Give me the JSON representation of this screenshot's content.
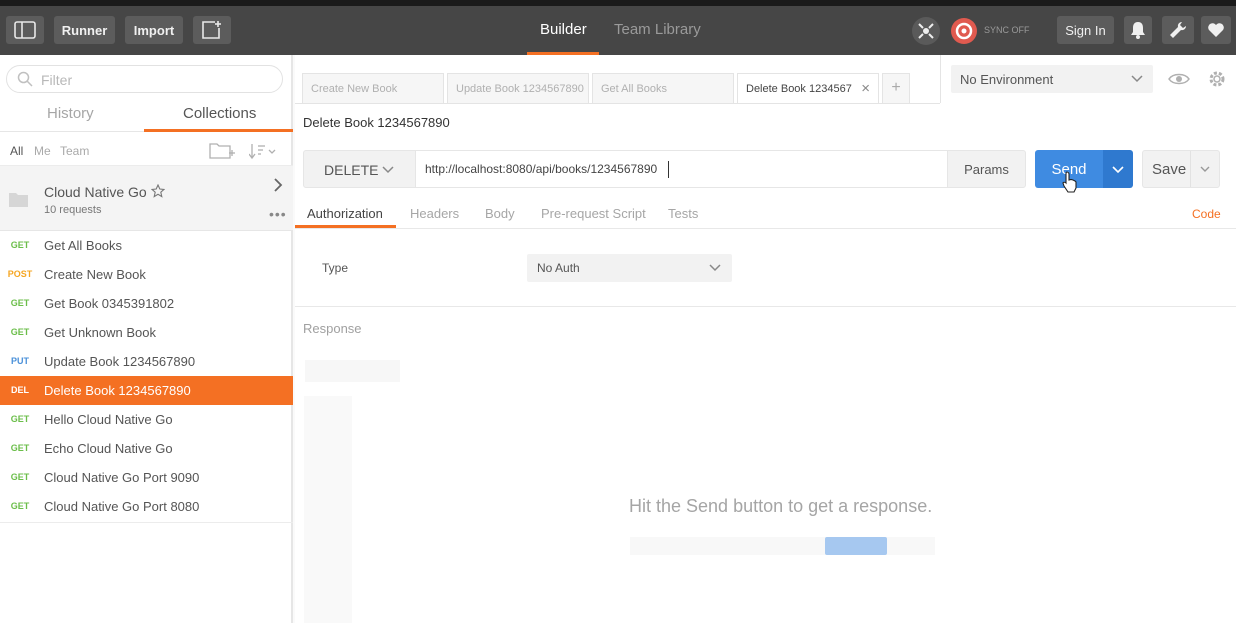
{
  "topbar": {
    "runner_label": "Runner",
    "import_label": "Import",
    "builder_label": "Builder",
    "team_library_label": "Team Library",
    "sync_label": "SYNC OFF",
    "sign_in_label": "Sign In",
    "accent_color": "#f47023"
  },
  "sidebar": {
    "filter_placeholder": "Filter",
    "tab_history": "History",
    "tab_collections": "Collections",
    "filter_all": "All",
    "filter_me": "Me",
    "filter_team": "Team",
    "collection_name": "Cloud Native Go",
    "collection_count": "10 requests",
    "requests": [
      {
        "method": "GET",
        "name": "Get All Books",
        "color": "#6bbe4a"
      },
      {
        "method": "POST",
        "name": "Create New Book",
        "color": "#f5a623"
      },
      {
        "method": "GET",
        "name": "Get Book 0345391802",
        "color": "#6bbe4a"
      },
      {
        "method": "GET",
        "name": "Get Unknown Book",
        "color": "#6bbe4a"
      },
      {
        "method": "PUT",
        "name": "Update Book 1234567890",
        "color": "#4a90d9"
      },
      {
        "method": "DEL",
        "name": "Delete Book 1234567890",
        "color": "#ffffff"
      },
      {
        "method": "GET",
        "name": "Hello Cloud Native Go",
        "color": "#6bbe4a"
      },
      {
        "method": "GET",
        "name": "Echo Cloud Native Go",
        "color": "#6bbe4a"
      },
      {
        "method": "GET",
        "name": "Cloud Native Go Port 9090",
        "color": "#6bbe4a"
      },
      {
        "method": "GET",
        "name": "Cloud Native Go Port 8080",
        "color": "#6bbe4a"
      }
    ]
  },
  "tabs": [
    "Create New Book",
    "Update Book 1234567890",
    "Get All Books",
    "Delete Book 1234567"
  ],
  "environment": "No Environment",
  "request": {
    "title": "Delete Book 1234567890",
    "method": "DELETE",
    "url": "http://localhost:8080/api/books/1234567890",
    "params_label": "Params",
    "send_label": "Send",
    "save_label": "Save"
  },
  "request_tabs": {
    "authorization": "Authorization",
    "headers": "Headers",
    "body": "Body",
    "prerequest": "Pre-request Script",
    "tests": "Tests",
    "code": "Code"
  },
  "auth": {
    "type_label": "Type",
    "type_value": "No Auth"
  },
  "response": {
    "label": "Response",
    "empty_message": "Hit the Send button to get a response."
  }
}
